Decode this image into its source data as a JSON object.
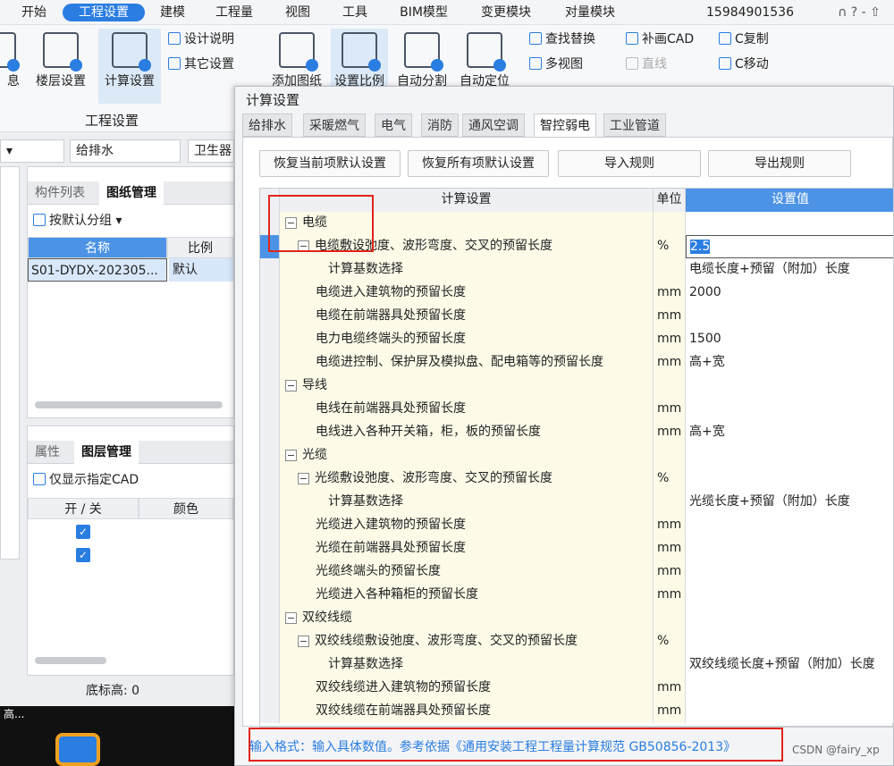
{
  "menu": [
    "开始",
    "工程设置",
    "建模",
    "工程量",
    "视图",
    "工具",
    "BIM模型",
    "变更模块",
    "对量模块"
  ],
  "menu_active": "工程设置",
  "phone": "15984901536",
  "header_icons": "∩ ? - ⇧",
  "ribbon": {
    "buttons": [
      "息",
      "楼层设置",
      "计算设置",
      "添加图纸",
      "设置比例",
      "自动分割",
      "自动定位"
    ],
    "small": [
      "设计说明",
      "其它设置",
      "查找替换",
      "补画CAD",
      "C复制",
      "多视图",
      "直线",
      "C移动"
    ],
    "group": "工程设置"
  },
  "left": {
    "dd1": "给排水",
    "dd2": "卫生器",
    "tab1": "构件列表",
    "tab2": "图纸管理",
    "group": "按默认分组",
    "col_name": "名称",
    "col_scale": "比例",
    "row_name": "S01-DYDX-202305...",
    "row_scale": "默认",
    "tab3": "属性",
    "tab4": "图层管理",
    "cad": "仅显示指定CAD",
    "col_onoff": "开 / 关",
    "col_color": "颜色",
    "bottom": "底标高: 0",
    "taskbar": "高..."
  },
  "dialog": {
    "title": "计算设置",
    "tabs": [
      "给排水",
      "采暖燃气",
      "电气",
      "消防",
      "通风空调",
      "智控弱电",
      "工业管道"
    ],
    "active_tab": "智控弱电",
    "buttons": [
      "恢复当前项默认设置",
      "恢复所有项默认设置",
      "导入规则",
      "导出规则"
    ],
    "headers": [
      "计算设置",
      "单位",
      "设置值"
    ],
    "rows": [
      {
        "lvl": 0,
        "tog": "−",
        "name": "电缆",
        "unit": "",
        "val": ""
      },
      {
        "lvl": 1,
        "tog": "−",
        "name": "电缆敷设弛度、波形弯度、交叉的预留长度",
        "unit": "%",
        "val": "2.5",
        "sel": true
      },
      {
        "lvl": 2,
        "tog": "",
        "name": "计算基数选择",
        "unit": "",
        "val": "电缆长度+预留（附加）长度"
      },
      {
        "lvl": 1,
        "tog": "",
        "name": "电缆进入建筑物的预留长度",
        "unit": "mm",
        "val": "2000"
      },
      {
        "lvl": 1,
        "tog": "",
        "name": "电缆在前端器具处预留长度",
        "unit": "mm",
        "val": ""
      },
      {
        "lvl": 1,
        "tog": "",
        "name": "电力电缆终端头的预留长度",
        "unit": "mm",
        "val": "1500"
      },
      {
        "lvl": 1,
        "tog": "",
        "name": "电缆进控制、保护屏及模拟盘、配电箱等的预留长度",
        "unit": "mm",
        "val": "高+宽"
      },
      {
        "lvl": 0,
        "tog": "−",
        "name": "导线",
        "unit": "",
        "val": ""
      },
      {
        "lvl": 1,
        "tog": "",
        "name": "电线在前端器具处预留长度",
        "unit": "mm",
        "val": ""
      },
      {
        "lvl": 1,
        "tog": "",
        "name": "电线进入各种开关箱，柜，板的预留长度",
        "unit": "mm",
        "val": "高+宽"
      },
      {
        "lvl": 0,
        "tog": "−",
        "name": "光缆",
        "unit": "",
        "val": ""
      },
      {
        "lvl": 1,
        "tog": "−",
        "name": "光缆敷设弛度、波形弯度、交叉的预留长度",
        "unit": "%",
        "val": ""
      },
      {
        "lvl": 2,
        "tog": "",
        "name": "计算基数选择",
        "unit": "",
        "val": "光缆长度+预留（附加）长度"
      },
      {
        "lvl": 1,
        "tog": "",
        "name": "光缆进入建筑物的预留长度",
        "unit": "mm",
        "val": ""
      },
      {
        "lvl": 1,
        "tog": "",
        "name": "光缆在前端器具处预留长度",
        "unit": "mm",
        "val": ""
      },
      {
        "lvl": 1,
        "tog": "",
        "name": "光缆终端头的预留长度",
        "unit": "mm",
        "val": ""
      },
      {
        "lvl": 1,
        "tog": "",
        "name": "光缆进入各种箱柜的预留长度",
        "unit": "mm",
        "val": ""
      },
      {
        "lvl": 0,
        "tog": "−",
        "name": "双绞线缆",
        "unit": "",
        "val": ""
      },
      {
        "lvl": 1,
        "tog": "−",
        "name": "双绞线缆敷设弛度、波形弯度、交叉的预留长度",
        "unit": "%",
        "val": ""
      },
      {
        "lvl": 2,
        "tog": "",
        "name": "计算基数选择",
        "unit": "",
        "val": "双绞线缆长度+预留（附加）长度"
      },
      {
        "lvl": 1,
        "tog": "",
        "name": "双绞线缆进入建筑物的预留长度",
        "unit": "mm",
        "val": ""
      },
      {
        "lvl": 1,
        "tog": "",
        "name": "双绞线缆在前端器具处预留长度",
        "unit": "mm",
        "val": ""
      }
    ],
    "footer": "输入格式：输入具体数值。参考依据《通用安装工程工程量计算规范 GB50856-2013》"
  },
  "watermark": "CSDN @fairy_xp"
}
